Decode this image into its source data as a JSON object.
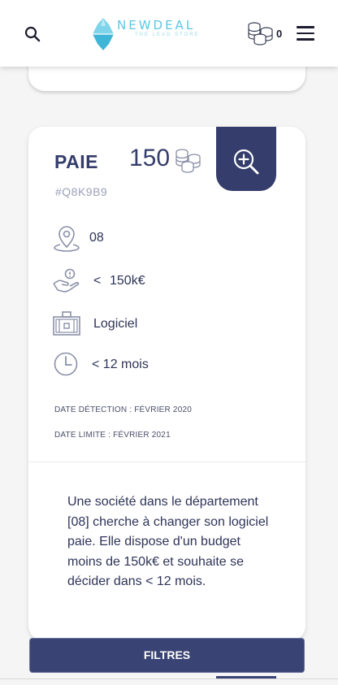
{
  "header": {
    "logo_title": "NEWDEAL",
    "logo_subtitle": "THE LEAD STORE",
    "coin_count": "0"
  },
  "lead": {
    "title": "PAIE",
    "price": "150",
    "reference": "#Q8K9B9",
    "department": "08",
    "budget_prefix": "<",
    "budget_value": "150k€",
    "category": "Logiciel",
    "timeframe": "< 12 mois",
    "detection_date": "DATE DÉTECTION : FÉVRIER 2020",
    "deadline_date": "DATE LIMITE : FÉVRIER 2021",
    "description": "Une société dans le département [08] cherche à changer son logiciel paie. Elle dispose d'un budget moins de 150k€ et souhaite se décider dans < 12 mois."
  },
  "footer": {
    "filters_label": "FILTRES"
  },
  "colors": {
    "primary": "#343d6b",
    "logo": "#5bc7e3",
    "icon": "#8a90a8"
  }
}
